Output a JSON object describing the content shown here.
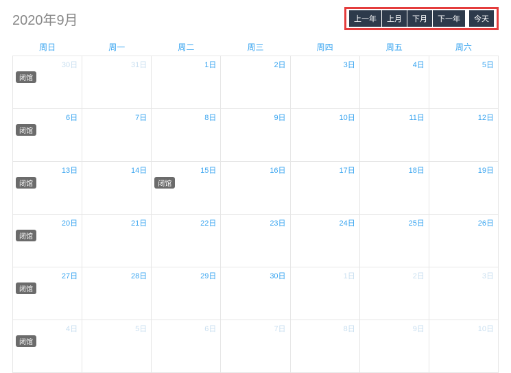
{
  "title": "2020年9月",
  "nav": {
    "prevYear": "上一年",
    "prevMonth": "上月",
    "nextMonth": "下月",
    "nextYear": "下一年",
    "today": "今天"
  },
  "weekdays": [
    "周日",
    "周一",
    "周二",
    "周三",
    "周四",
    "周五",
    "周六"
  ],
  "badgeLabel": "闭馆",
  "weeks": [
    [
      {
        "label": "30日",
        "muted": true,
        "badge": true
      },
      {
        "label": "31日",
        "muted": true
      },
      {
        "label": "1日"
      },
      {
        "label": "2日"
      },
      {
        "label": "3日"
      },
      {
        "label": "4日"
      },
      {
        "label": "5日"
      }
    ],
    [
      {
        "label": "6日",
        "badge": true
      },
      {
        "label": "7日"
      },
      {
        "label": "8日"
      },
      {
        "label": "9日"
      },
      {
        "label": "10日"
      },
      {
        "label": "11日"
      },
      {
        "label": "12日"
      }
    ],
    [
      {
        "label": "13日",
        "badge": true
      },
      {
        "label": "14日"
      },
      {
        "label": "15日",
        "badge": true
      },
      {
        "label": "16日"
      },
      {
        "label": "17日"
      },
      {
        "label": "18日"
      },
      {
        "label": "19日"
      }
    ],
    [
      {
        "label": "20日",
        "badge": true
      },
      {
        "label": "21日"
      },
      {
        "label": "22日"
      },
      {
        "label": "23日"
      },
      {
        "label": "24日"
      },
      {
        "label": "25日"
      },
      {
        "label": "26日"
      }
    ],
    [
      {
        "label": "27日",
        "badge": true
      },
      {
        "label": "28日"
      },
      {
        "label": "29日"
      },
      {
        "label": "30日"
      },
      {
        "label": "1日",
        "muted": true
      },
      {
        "label": "2日",
        "muted": true
      },
      {
        "label": "3日",
        "muted": true
      }
    ],
    [
      {
        "label": "4日",
        "muted": true,
        "badge": true
      },
      {
        "label": "5日",
        "muted": true
      },
      {
        "label": "6日",
        "muted": true
      },
      {
        "label": "7日",
        "muted": true
      },
      {
        "label": "8日",
        "muted": true
      },
      {
        "label": "9日",
        "muted": true
      },
      {
        "label": "10日",
        "muted": true
      }
    ]
  ]
}
